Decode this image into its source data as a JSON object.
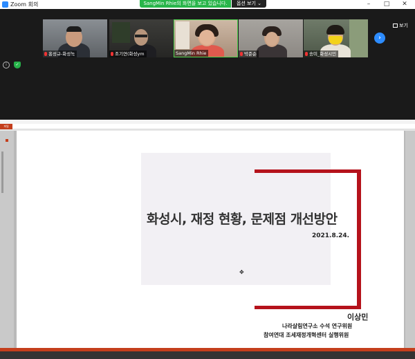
{
  "window": {
    "title": "Zoom 회의",
    "controls": {
      "minimize": "–",
      "maximize": "□",
      "close": "✕"
    }
  },
  "share_banner": {
    "message": "SangMin Rhie의 화면을 보고 있습니다.",
    "options_label": "옵션 보기 ⌄"
  },
  "gallery": {
    "view_button_label": "보기",
    "next_icon": "chevron-right-icon",
    "participants": [
      {
        "name": "홍성규-화성녹",
        "muted": true
      },
      {
        "name": "조기연(화성ym",
        "muted": true
      },
      {
        "name": "SangMin Rhie",
        "muted": false
      },
      {
        "name": "박준순",
        "muted": true
      },
      {
        "name": "송미_화성시민",
        "muted": true
      }
    ]
  },
  "shared_screen": {
    "ppt_file_tab": "파일",
    "slide": {
      "title": "화성시, 재정 현황, 문제점 개선방안",
      "date": "2021.8.24.",
      "presenter": "이상민",
      "affiliation1": "나라살림연구소 수석 연구위원",
      "affiliation2": "참여연대 조세재정개혁센터 실행위원"
    }
  },
  "colors": {
    "accent_red": "#b5121b",
    "zoom_blue": "#2d8cff",
    "banner_green": "#28b54a"
  }
}
